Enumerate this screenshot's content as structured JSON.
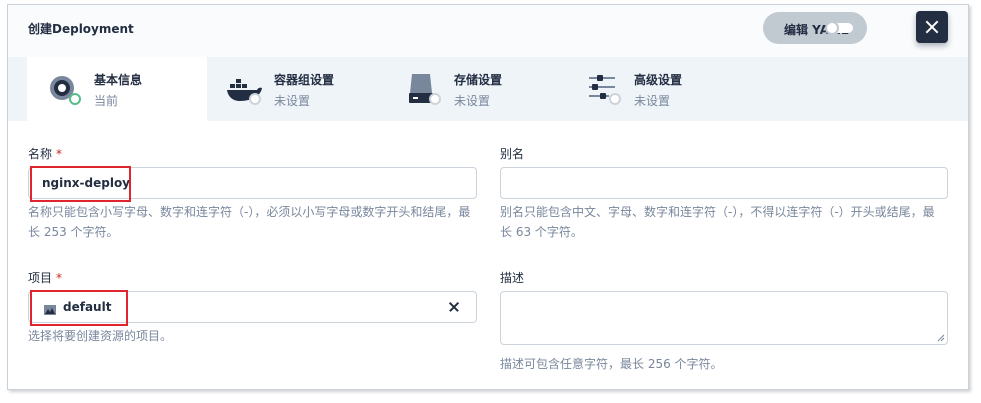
{
  "header": {
    "title": "创建Deployment",
    "yaml_label": "编辑 YAML",
    "close_icon": "close-icon"
  },
  "tabs": [
    {
      "title": "基本信息",
      "status": "当前",
      "icon": "basic-info-icon"
    },
    {
      "title": "容器组设置",
      "status": "未设置",
      "icon": "docker-icon"
    },
    {
      "title": "存储设置",
      "status": "未设置",
      "icon": "storage-icon"
    },
    {
      "title": "高级设置",
      "status": "未设置",
      "icon": "sliders-icon"
    }
  ],
  "form": {
    "name": {
      "label": "名称",
      "required_mark": "*",
      "value": "nginx-deploy",
      "hint_line1": "名称只能包含小写字母、数字和连字符（-），必须以小写字母或数字开头和结尾，最",
      "hint_line2": "长 253 个字符。"
    },
    "alias": {
      "label": "别名",
      "value": "",
      "hint_line1": "别名只能包含中文、字母、数字和连字符（-），不得以连字符（-）开头或结尾，最",
      "hint_line2": "长 63 个字符。"
    },
    "project": {
      "label": "项目",
      "required_mark": "*",
      "value": "default",
      "hint": "选择将要创建资源的项目。"
    },
    "description": {
      "label": "描述",
      "value": "",
      "hint": "描述可包含任意字符，最长 256 个字符。"
    }
  },
  "colors": {
    "accent_green": "#55bc8a",
    "dark": "#242e42",
    "highlight_red": "#e0252e"
  }
}
